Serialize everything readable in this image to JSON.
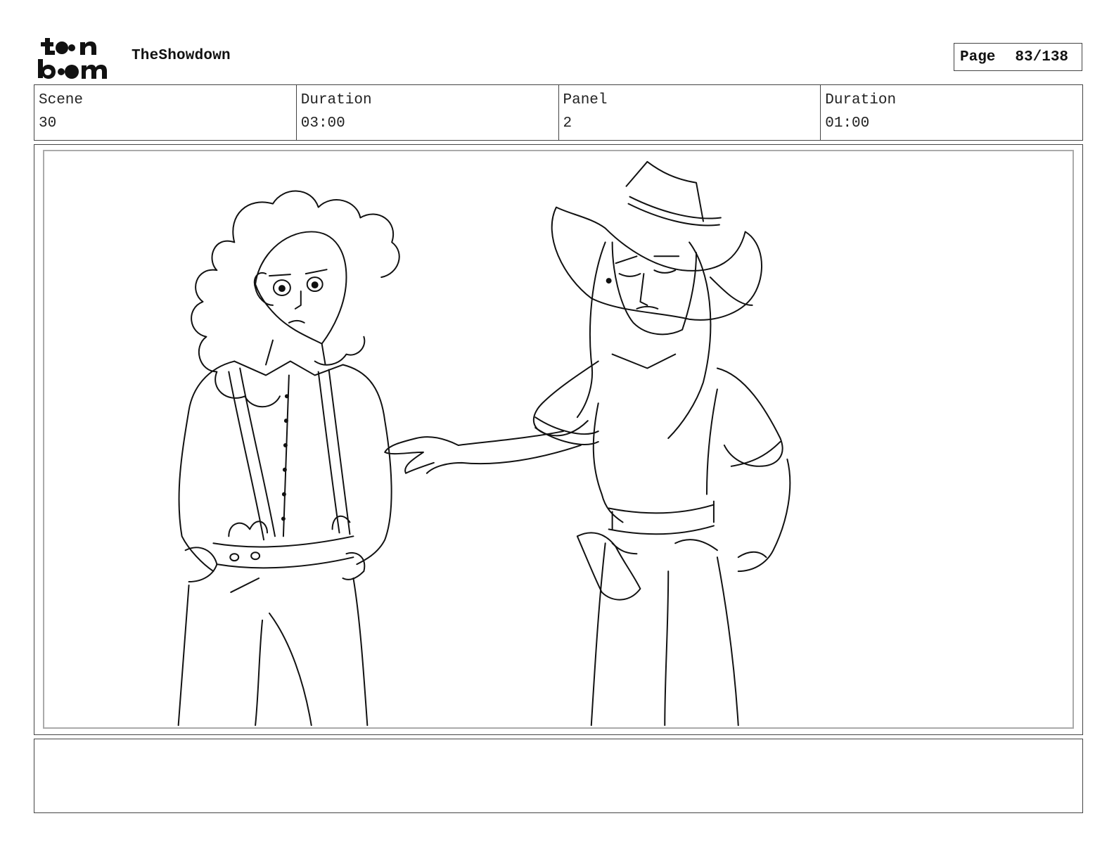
{
  "header": {
    "logo_line1": "toon",
    "logo_line2": "boom",
    "project_title": "TheShowdown",
    "page_label": "Page",
    "page_value": "83/138"
  },
  "info": {
    "scene_label": "Scene",
    "scene_value": "30",
    "scene_duration_label": "Duration",
    "scene_duration_value": "03:00",
    "panel_label": "Panel",
    "panel_value": "2",
    "panel_duration_label": "Duration",
    "panel_duration_value": "01:00"
  },
  "notes": {
    "text": ""
  }
}
